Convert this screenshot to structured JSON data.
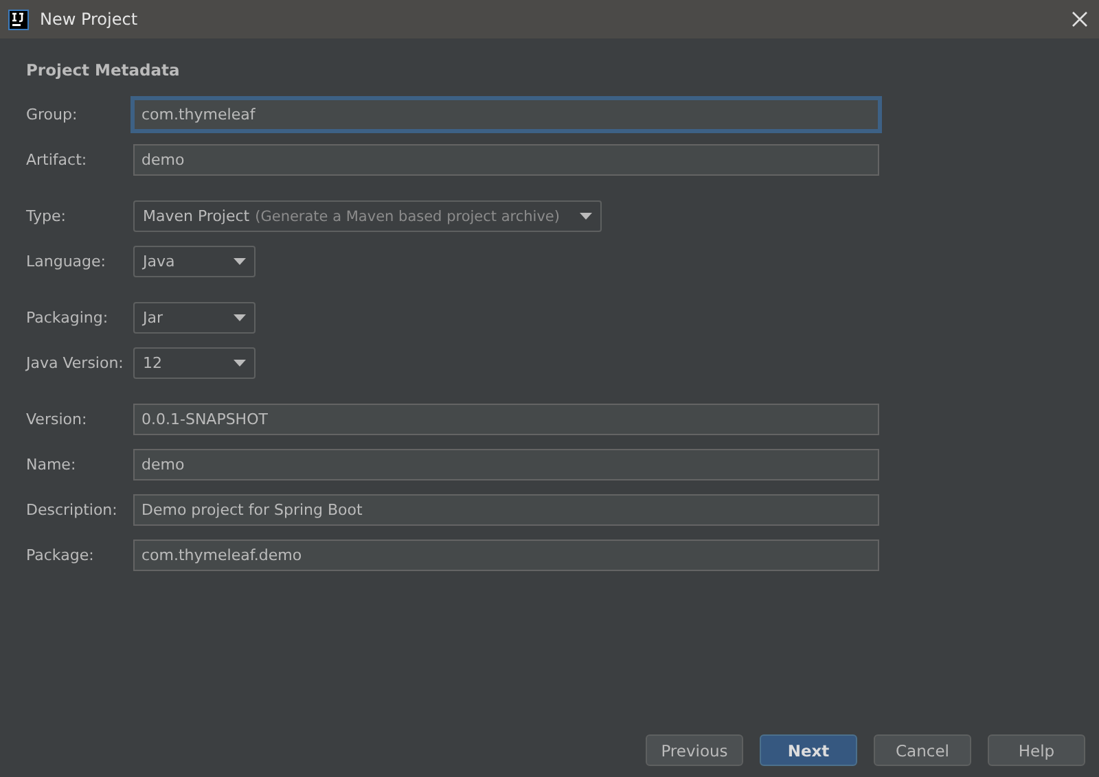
{
  "window": {
    "title": "New Project"
  },
  "section_title": "Project Metadata",
  "groups": [
    {
      "fields": [
        {
          "kind": "text",
          "label": "Group:",
          "value": "com.thymeleaf",
          "focused": true
        },
        {
          "kind": "text",
          "label": "Artifact:",
          "value": "demo",
          "focused": false
        }
      ]
    },
    {
      "fields": [
        {
          "kind": "dropdown",
          "label": "Type:",
          "value": "Maven Project",
          "hint": "(Generate a Maven based project archive)"
        },
        {
          "kind": "dropdown",
          "label": "Language:",
          "value": "Java"
        }
      ]
    },
    {
      "fields": [
        {
          "kind": "dropdown",
          "label": "Packaging:",
          "value": "Jar"
        },
        {
          "kind": "dropdown",
          "label": "Java Version:",
          "value": "12"
        }
      ]
    },
    {
      "fields": [
        {
          "kind": "text",
          "label": "Version:",
          "value": "0.0.1-SNAPSHOT",
          "focused": false
        },
        {
          "kind": "text",
          "label": "Name:",
          "value": "demo",
          "focused": false
        },
        {
          "kind": "text",
          "label": "Description:",
          "value": "Demo project for Spring Boot",
          "focused": false
        },
        {
          "kind": "text",
          "label": "Package:",
          "value": "com.thymeleaf.demo",
          "focused": false
        }
      ]
    }
  ],
  "buttons": [
    {
      "label": "Previous",
      "default": false
    },
    {
      "label": "Next",
      "default": true
    },
    {
      "label": "Cancel",
      "default": false
    },
    {
      "label": "Help",
      "default": false
    }
  ]
}
